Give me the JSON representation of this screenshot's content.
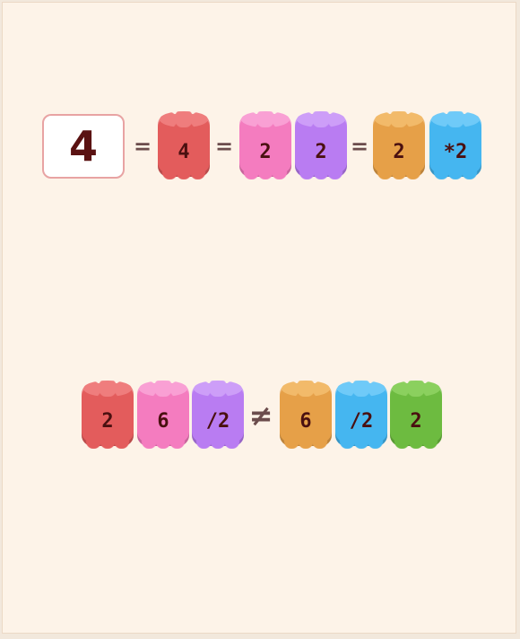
{
  "equation1": {
    "target": "4",
    "eq_sign": "=",
    "tiles": [
      {
        "label": "4",
        "color": "red"
      },
      {
        "label": "2",
        "color": "pink"
      },
      {
        "label": "2",
        "color": "purple"
      },
      {
        "label": "2",
        "color": "orange"
      },
      {
        "label": "*2",
        "color": "blue"
      }
    ]
  },
  "equation2": {
    "ne_sign": "≠",
    "left_tiles": [
      {
        "label": "2",
        "color": "red"
      },
      {
        "label": "6",
        "color": "pink"
      },
      {
        "label": "/2",
        "color": "purple"
      }
    ],
    "right_tiles": [
      {
        "label": "6",
        "color": "orange"
      },
      {
        "label": "/2",
        "color": "blue"
      },
      {
        "label": "2",
        "color": "green"
      }
    ]
  },
  "colors": {
    "background": "#fdf3e8",
    "red": "#e35c5c",
    "pink": "#f47cbf",
    "purple": "#b97cf2",
    "orange": "#e6a048",
    "blue": "#45b6f0",
    "green": "#6dbb40",
    "text": "#4a1010"
  }
}
